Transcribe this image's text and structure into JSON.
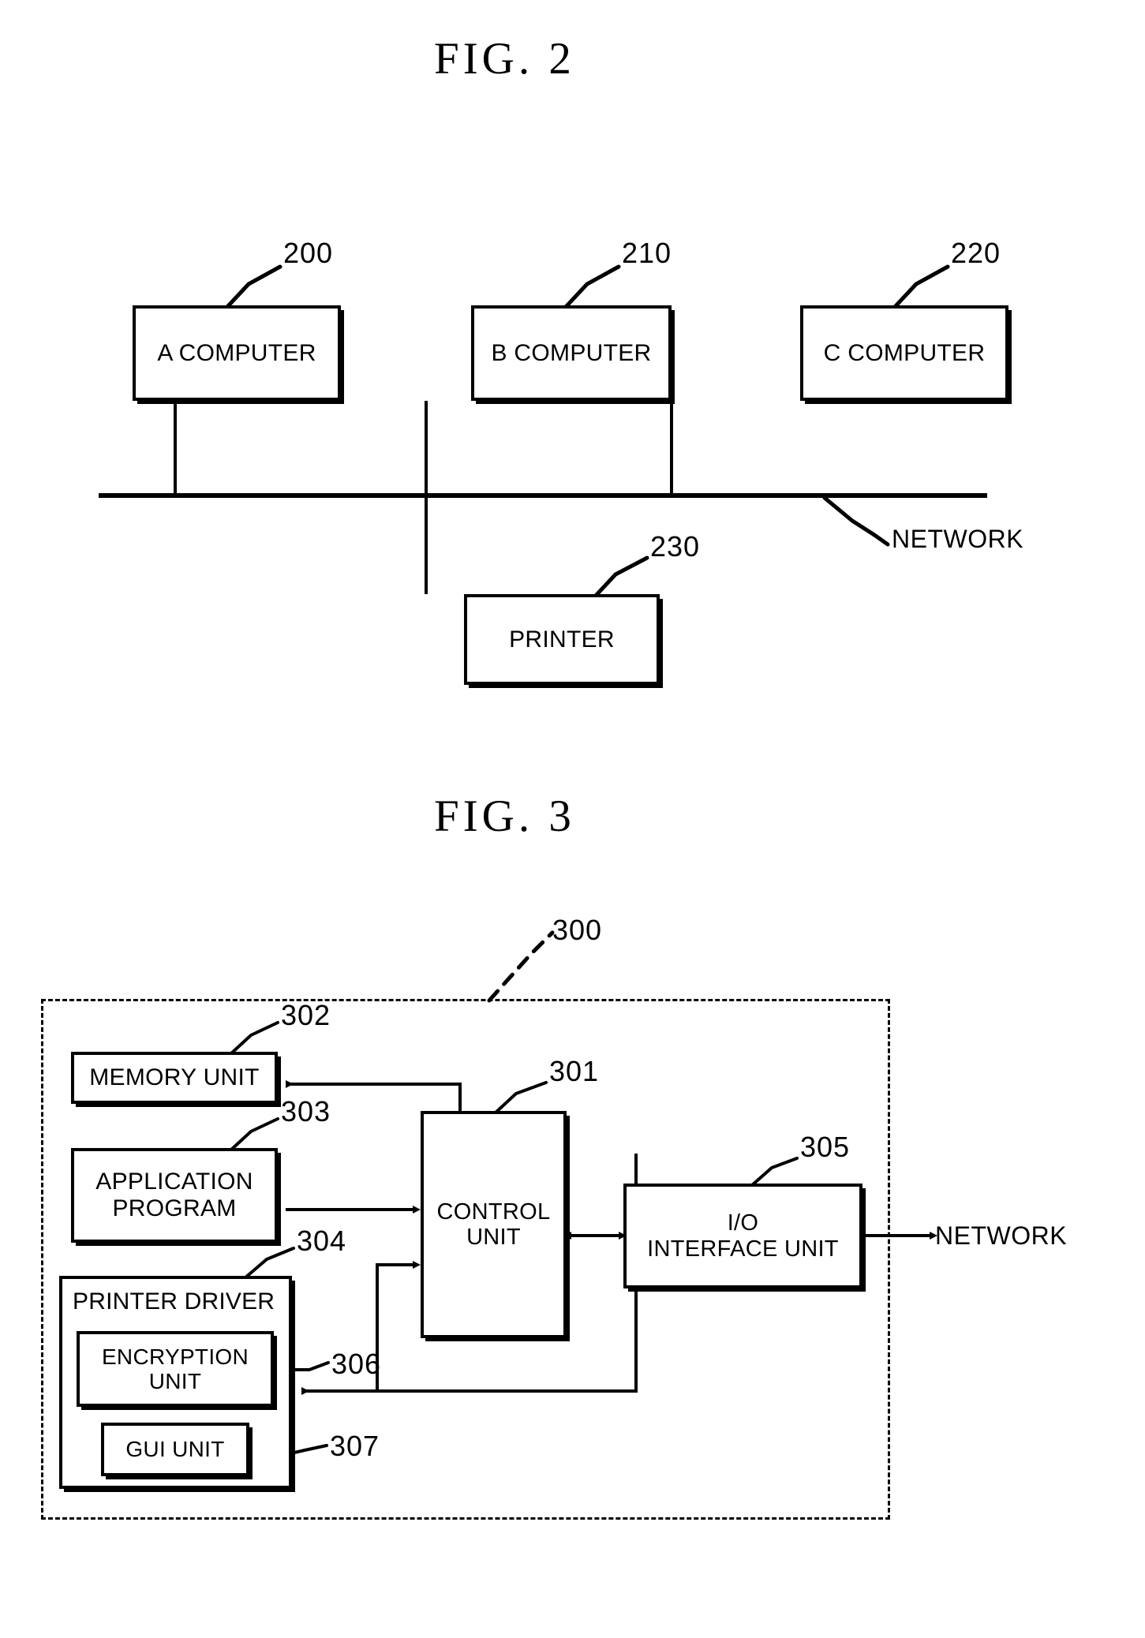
{
  "figures": [
    {
      "title": "FIG. 2",
      "nodes": [
        {
          "id": "a-computer",
          "label": "A COMPUTER",
          "ref": "200"
        },
        {
          "id": "b-computer",
          "label": "B COMPUTER",
          "ref": "210"
        },
        {
          "id": "c-computer",
          "label": "C COMPUTER",
          "ref": "220"
        },
        {
          "id": "printer",
          "label": "PRINTER",
          "ref": "230"
        }
      ],
      "bus_label": "NETWORK"
    },
    {
      "title": "FIG. 3",
      "enclosure_ref": "300",
      "nodes": [
        {
          "id": "memory-unit",
          "label": "MEMORY UNIT",
          "ref": "302"
        },
        {
          "id": "application-program",
          "label": "APPLICATION\nPROGRAM",
          "ref": "303"
        },
        {
          "id": "printer-driver",
          "label": "PRINTER DRIVER",
          "ref": "304"
        },
        {
          "id": "encryption-unit",
          "label": "ENCRYPTION\nUNIT",
          "ref": "306"
        },
        {
          "id": "gui-unit",
          "label": "GUI UNIT",
          "ref": "307"
        },
        {
          "id": "control-unit",
          "label": "CONTROL\nUNIT",
          "ref": "301"
        },
        {
          "id": "io-interface-unit",
          "label": "I/O\nINTERFACE UNIT",
          "ref": "305"
        }
      ],
      "external_label": "NETWORK"
    }
  ],
  "fig2": {
    "title": "FIG. 2",
    "a_computer": "A COMPUTER",
    "b_computer": "B COMPUTER",
    "c_computer": "C COMPUTER",
    "printer": "PRINTER",
    "network": "NETWORK",
    "ref_200": "200",
    "ref_210": "210",
    "ref_220": "220",
    "ref_230": "230"
  },
  "fig3": {
    "title": "FIG. 3",
    "memory_unit": "MEMORY UNIT",
    "application_program_line1": "APPLICATION",
    "application_program_line2": "PROGRAM",
    "printer_driver": "PRINTER DRIVER",
    "encryption_unit_line1": "ENCRYPTION",
    "encryption_unit_line2": "UNIT",
    "gui_unit": "GUI UNIT",
    "control_unit_line1": "CONTROL",
    "control_unit_line2": "UNIT",
    "io_interface_line1": "I/O",
    "io_interface_line2": "INTERFACE UNIT",
    "network": "NETWORK",
    "ref_300": "300",
    "ref_301": "301",
    "ref_302": "302",
    "ref_303": "303",
    "ref_304": "304",
    "ref_305": "305",
    "ref_306": "306",
    "ref_307": "307"
  },
  "colors": {
    "ink": "#000000",
    "paper": "#ffffff"
  }
}
